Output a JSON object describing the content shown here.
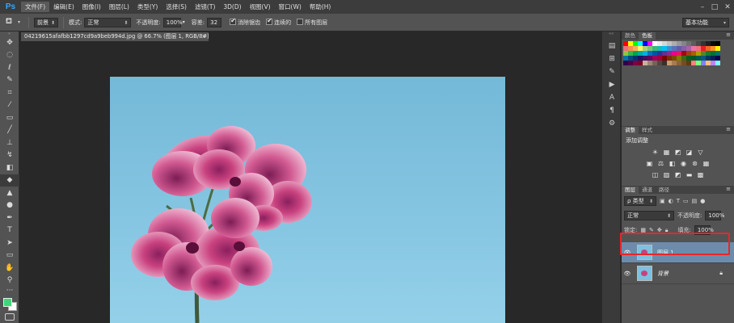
{
  "app": {
    "logo": "Ps"
  },
  "menu": [
    "文件(F)",
    "编辑(E)",
    "图像(I)",
    "图层(L)",
    "类型(Y)",
    "选择(S)",
    "滤镜(T)",
    "3D(D)",
    "视图(V)",
    "窗口(W)",
    "帮助(H)"
  ],
  "options": {
    "preset_value": "前景",
    "mode_label": "模式:",
    "mode_value": "正常",
    "opacity_label": "不透明度:",
    "opacity_value": "100%",
    "tolerance_label": "容差:",
    "tolerance_value": "32",
    "antialias_label": "消除锯齿",
    "contiguous_label": "连续的",
    "all_layers_label": "所有图层",
    "workspace_value": "基本功能"
  },
  "document": {
    "tab_title": "04219615afafbb1297cd9a9beb994d.jpg @ 66.7% (图层 1, RGB/8#) *",
    "close": "×"
  },
  "swatches_panel": {
    "tabs": [
      "颜色",
      "色板"
    ]
  },
  "adjust_panel": {
    "tabs": [
      "调整",
      "样式"
    ],
    "title": "添加调整"
  },
  "layers_panel": {
    "tabs": [
      "图层",
      "通道",
      "路径"
    ],
    "filter_label": "ρ 类型",
    "blend_mode": "正常",
    "opacity_label": "不透明度:",
    "opacity_value": "100%",
    "lock_label": "锁定:",
    "fill_label": "填充:",
    "fill_value": "100%",
    "layers": [
      {
        "name": "图层 1",
        "selected": true
      },
      {
        "name": "背景",
        "selected": false
      }
    ]
  },
  "colors": {
    "accent": "#31a8ff",
    "foreground": "#3dd77a",
    "background": "#ffffff",
    "highlight": "#e8262b",
    "selected_layer": "#6d8cad"
  },
  "icons": {
    "tools": [
      "move-icon",
      "marquee-icon",
      "lasso-icon",
      "quick-select-icon",
      "crop-icon",
      "eyedropper-icon",
      "healing-icon",
      "brush-icon",
      "clone-stamp-icon",
      "history-brush-icon",
      "eraser-icon",
      "paint-bucket-icon",
      "blur-icon",
      "dodge-icon",
      "pen-icon",
      "type-icon",
      "path-select-icon",
      "rectangle-icon",
      "hand-icon",
      "zoom-icon"
    ]
  }
}
